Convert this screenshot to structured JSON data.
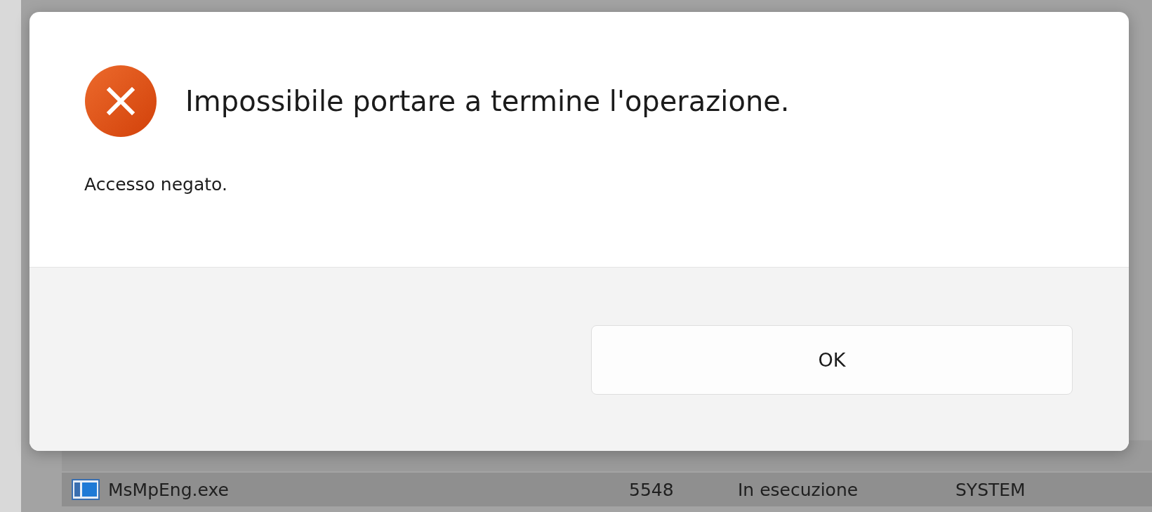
{
  "dialog": {
    "title": "Impossibile portare a termine l'operazione.",
    "message": "Accesso negato.",
    "buttons": [
      "OK"
    ]
  },
  "process_table": {
    "rows": [
      {
        "name": "MsMpEng.exe",
        "pid": "5548",
        "status": "In esecuzione",
        "user": "SYSTEM",
        "selected": true
      }
    ]
  }
}
